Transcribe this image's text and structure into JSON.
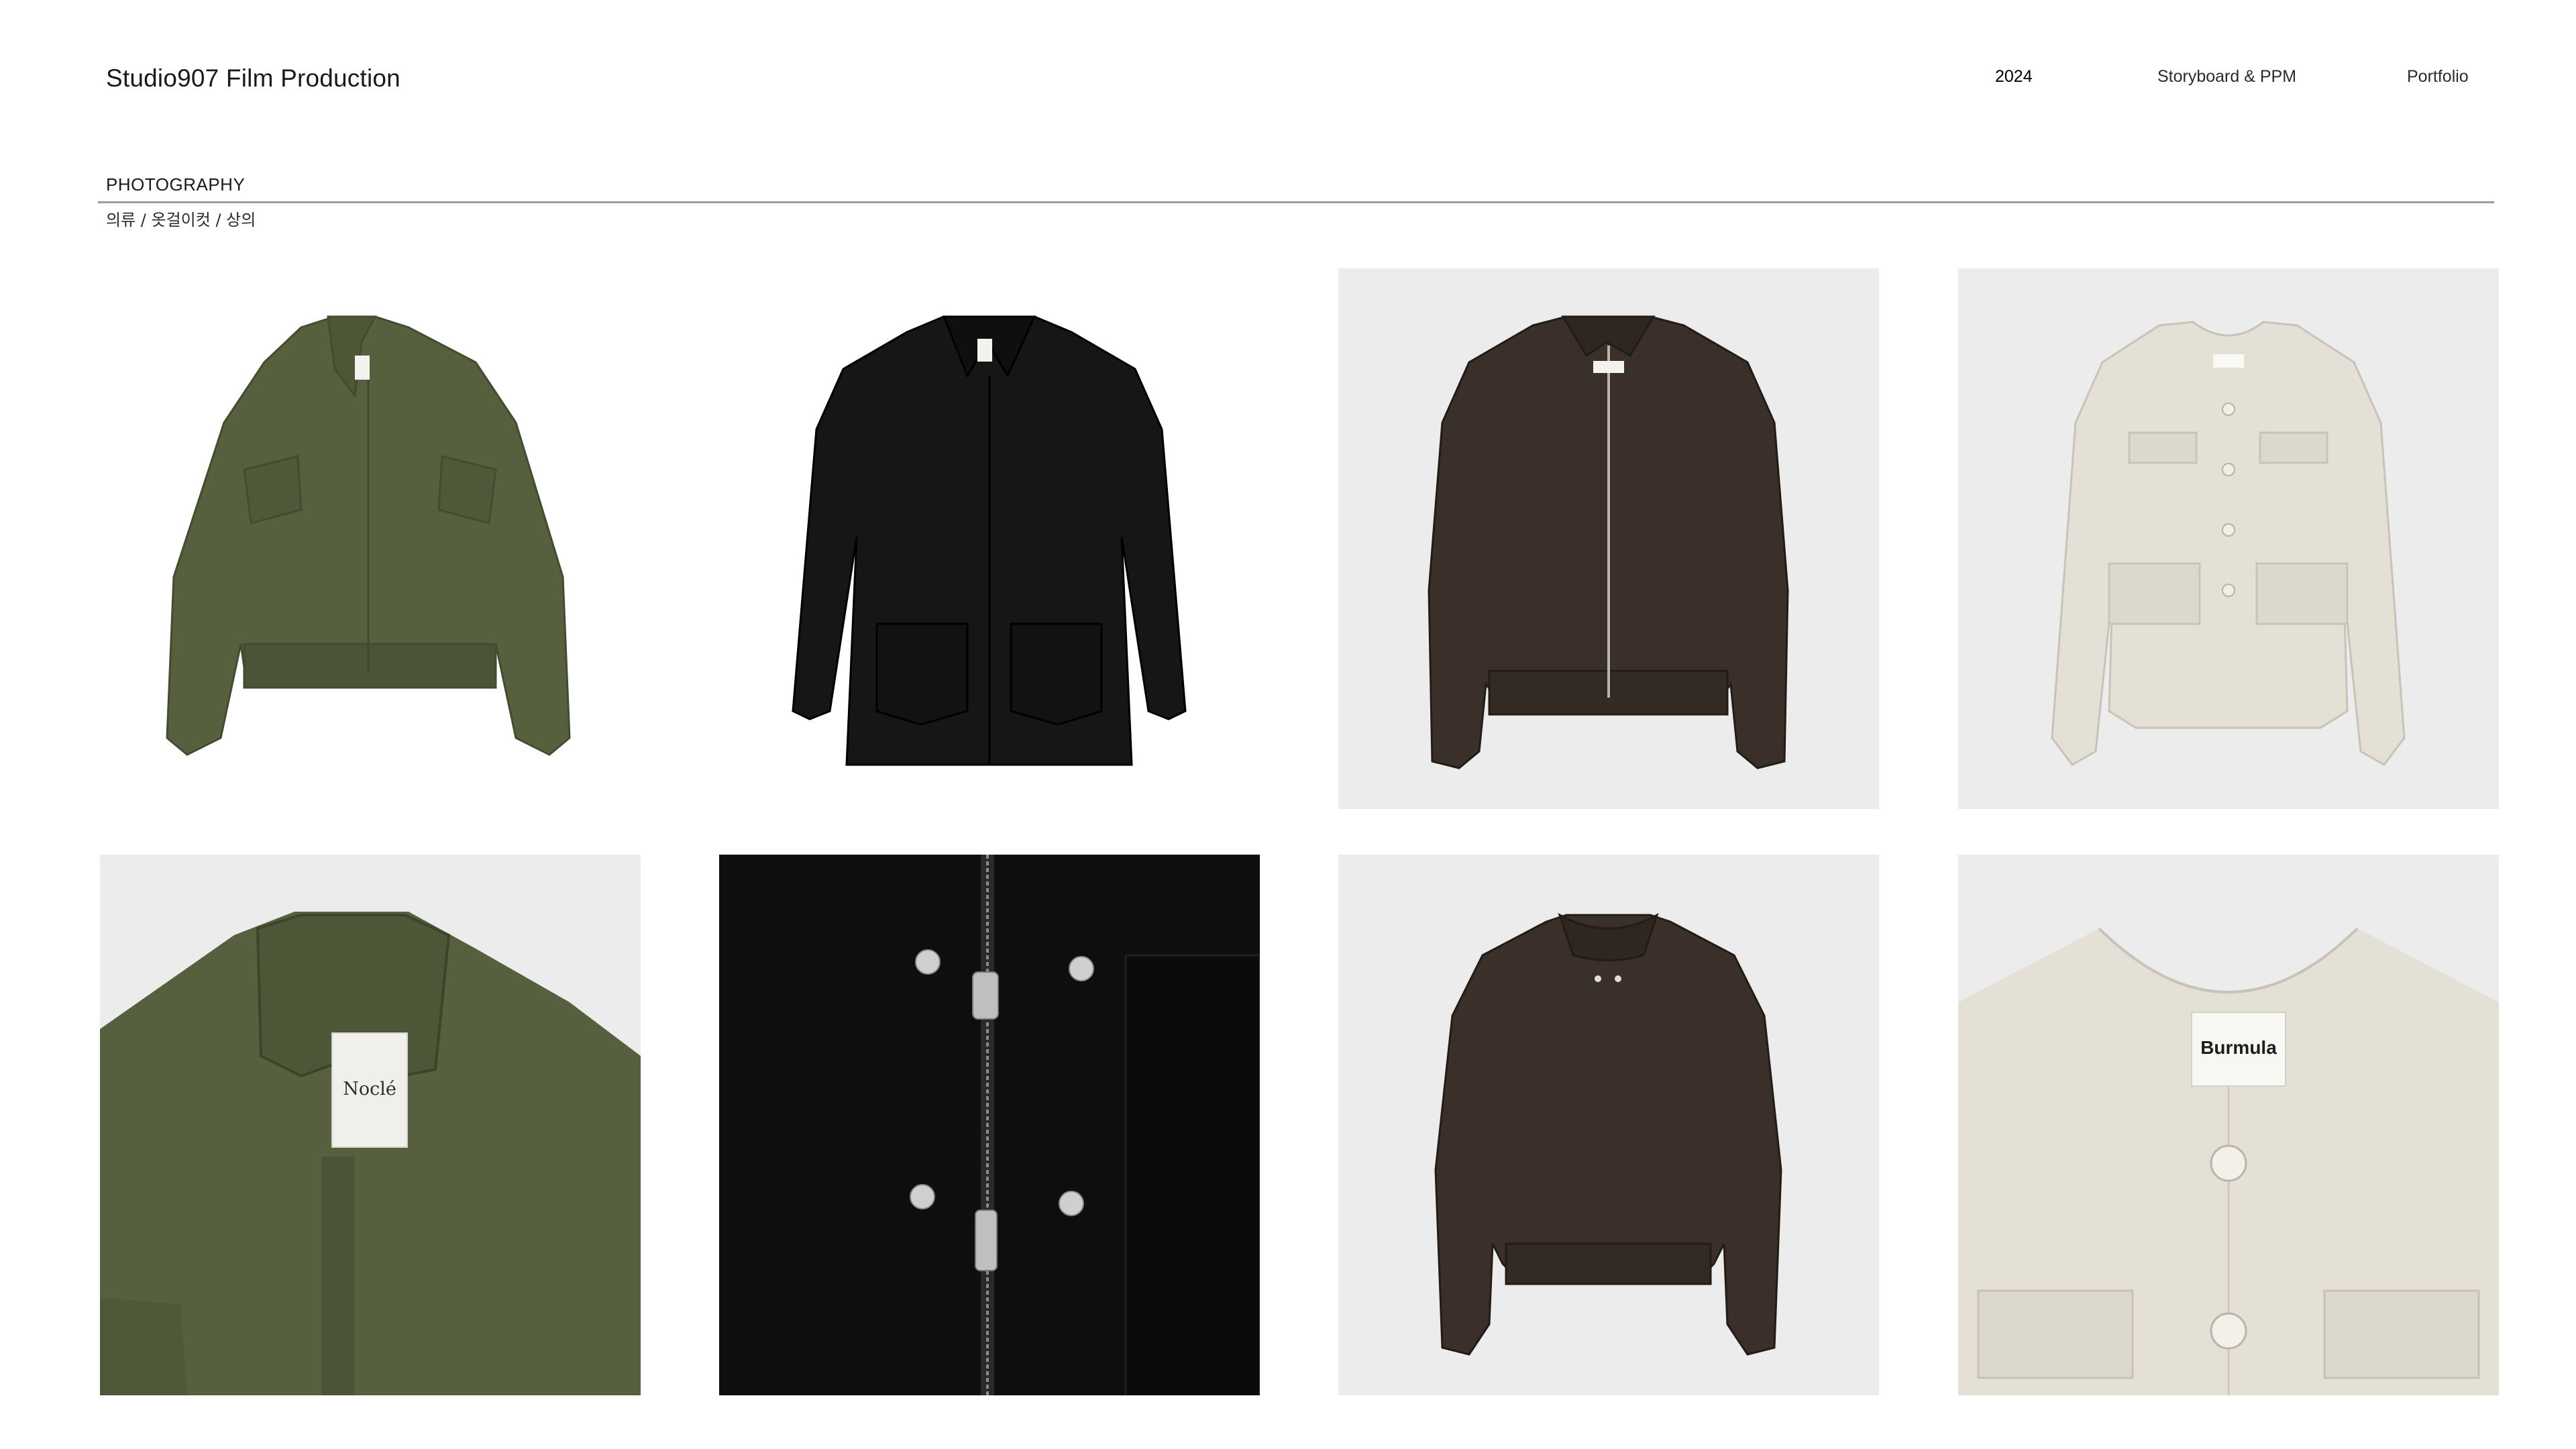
{
  "header": {
    "brand": "Studio907 Film Production",
    "nav": [
      {
        "label": "2024"
      },
      {
        "label": "Storyboard & PPM"
      },
      {
        "label": "Portfolio"
      }
    ]
  },
  "section": {
    "title": "PHOTOGRAPHY",
    "breadcrumb": "의류 / 옷걸이컷 / 상의"
  },
  "gallery": {
    "tiles": [
      {
        "subject": "olive bomber jacket",
        "bg": "#ffffff"
      },
      {
        "subject": "black field jacket",
        "bg": "#ffffff"
      },
      {
        "subject": "brown leather jacket front",
        "bg": "#ececec"
      },
      {
        "subject": "cream collarless jacket",
        "bg": "#ececec"
      },
      {
        "subject": "olive jacket collar detail",
        "label": "Noclé"
      },
      {
        "subject": "black jacket zipper detail"
      },
      {
        "subject": "brown leather jacket back",
        "bg": "#ececec"
      },
      {
        "subject": "cream jacket neckline detail",
        "label": "Burmula"
      }
    ],
    "labels": {
      "olive": "Noclé",
      "cream": "Burmula"
    },
    "colors": {
      "olive": "#56603f",
      "black": "#161616",
      "brown": "#3b3029",
      "cream": "#e4e0d6",
      "tile_bg": "#ececec"
    }
  }
}
